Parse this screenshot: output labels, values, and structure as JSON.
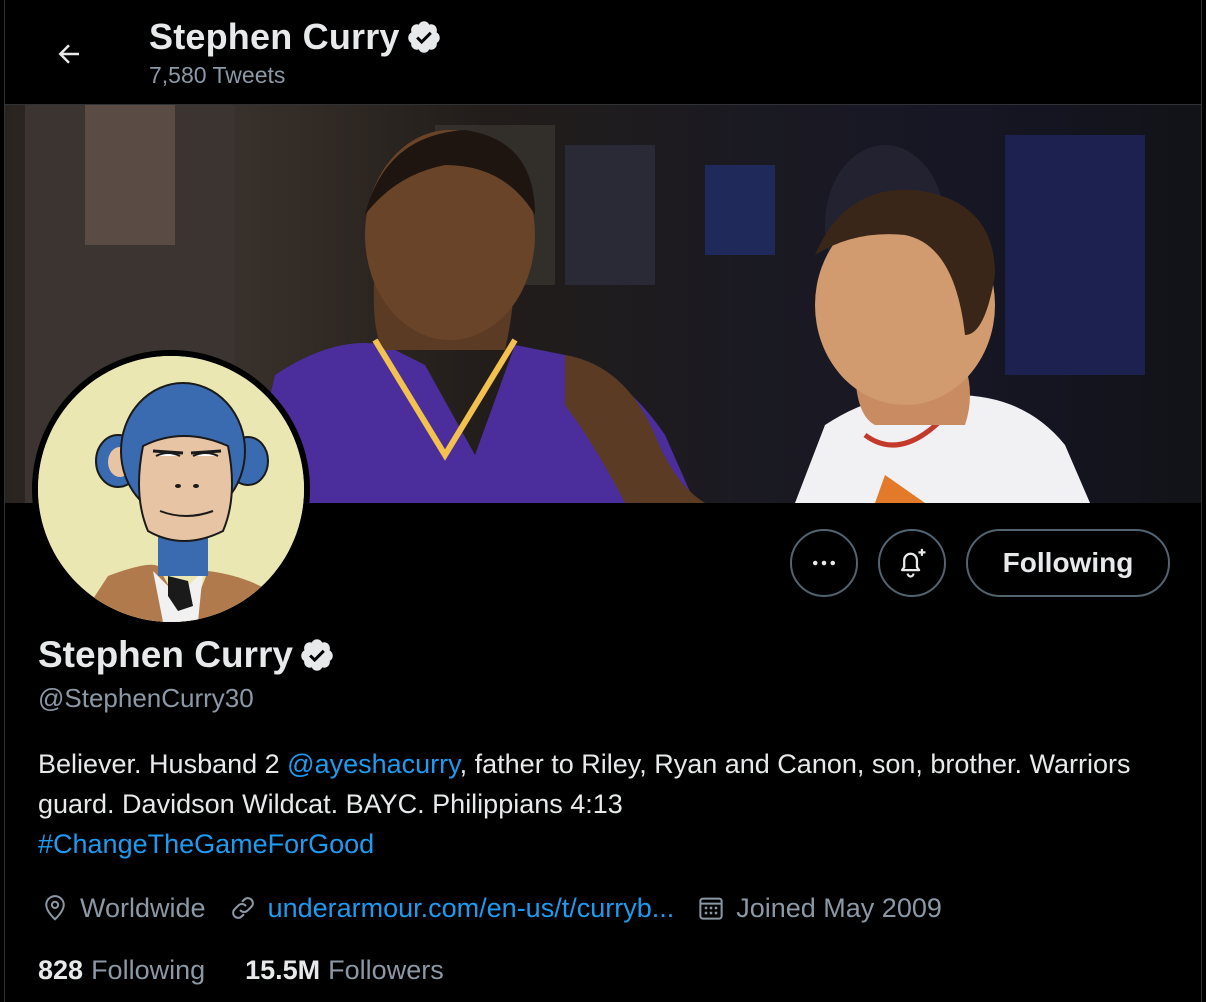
{
  "header": {
    "name": "Stephen Curry",
    "tweet_count": "7,580 Tweets"
  },
  "profile": {
    "name": "Stephen Curry",
    "handle": "@StephenCurry30",
    "bio": {
      "part1": "Believer. Husband 2 ",
      "mention": "@ayeshacurry",
      "part2": ", father to Riley, Ryan and Canon, son, brother. Warriors guard. Davidson Wildcat. BAYC. Philippians 4:13",
      "hashtag": "#ChangeTheGameForGood"
    },
    "location": "Worldwide",
    "website": "underarmour.com/en-us/t/curryb...",
    "joined": "Joined May 2009",
    "following_count": "828",
    "following_label": "Following",
    "followers_count": "15.5M",
    "followers_label": "Followers"
  },
  "actions": {
    "more_label": "•••",
    "following_button": "Following"
  },
  "icons": {
    "back": "arrow-left-icon",
    "verified": "verified-badge-icon",
    "more": "more-dots-icon",
    "notify": "bell-plus-icon",
    "location": "location-pin-icon",
    "link": "link-icon",
    "calendar": "calendar-icon"
  },
  "colors": {
    "background": "#000000",
    "text_primary": "#e7e9ea",
    "text_secondary": "#8b98a5",
    "accent": "#1d9bf0",
    "border": "#536471"
  }
}
